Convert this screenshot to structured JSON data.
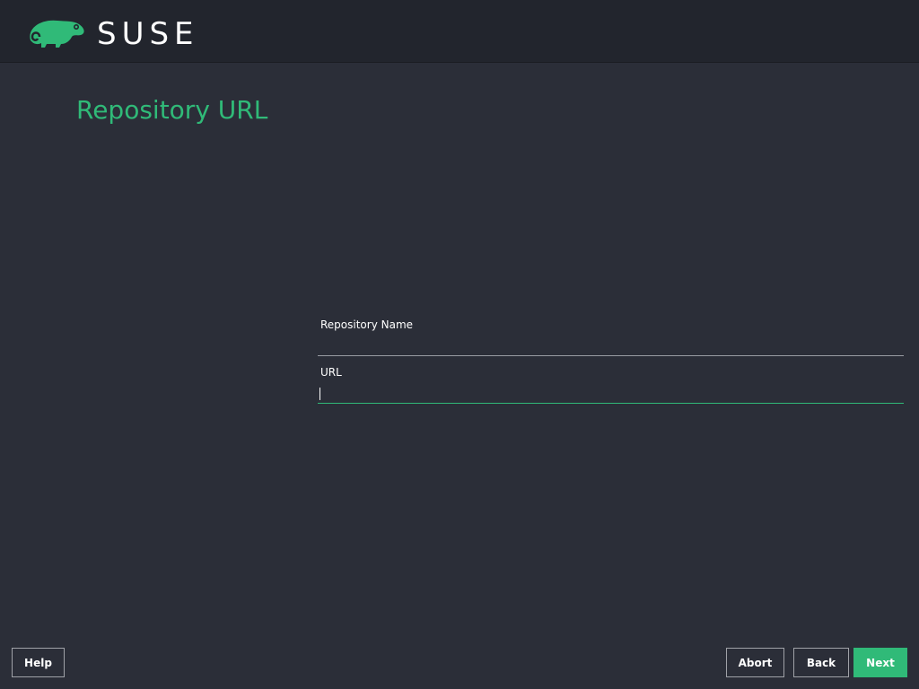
{
  "header": {
    "brand": "SUSE",
    "logo_icon": "chameleon-icon",
    "brand_color": "#30ba78"
  },
  "main": {
    "title": "Repository URL"
  },
  "form": {
    "name_label": "Repository Name",
    "name_value": "",
    "url_label": "URL",
    "url_value": ""
  },
  "buttons": {
    "help": "Help",
    "abort": "Abort",
    "back": "Back",
    "next": "Next"
  }
}
